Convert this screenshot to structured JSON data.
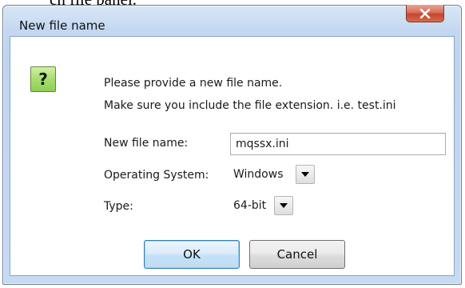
{
  "page": {
    "top_caption": "ch file panel."
  },
  "dialog": {
    "title": "New file name",
    "close_glyph": "x",
    "icon": "question-mark-icon",
    "icon_glyph": "?",
    "message_line1": "Please provide a new file name.",
    "message_line2": "Make sure you include the file extension. i.e. test.ini",
    "file_name_label": "New file name:",
    "file_name_value": "mqssx.ini",
    "os_label": "Operating System:",
    "os_value": "Windows",
    "type_label": "Type:",
    "type_value": "64-bit",
    "ok_label": "OK",
    "cancel_label": "Cancel"
  },
  "colors": {
    "frame": "#c3d8f0",
    "close_button": "#c7432d",
    "icon_green": "#a8dd6e",
    "default_button_border": "#3c7fb1"
  }
}
